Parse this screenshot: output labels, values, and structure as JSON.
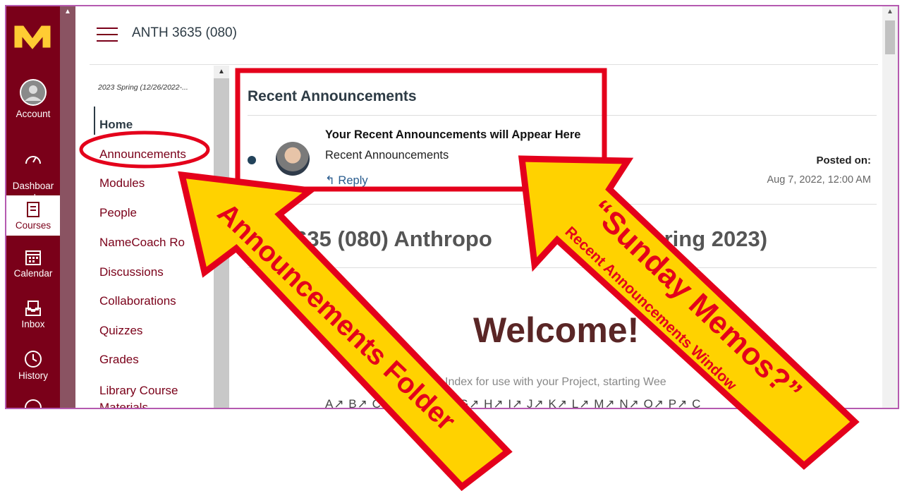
{
  "global_nav": {
    "logo": "M",
    "items": [
      {
        "label": "Account",
        "icon": "account-icon"
      },
      {
        "label": "Dashboar\nd",
        "icon": "dashboard-icon"
      },
      {
        "label": "Courses",
        "icon": "courses-icon"
      },
      {
        "label": "Calendar",
        "icon": "calendar-icon"
      },
      {
        "label": "Inbox",
        "icon": "inbox-icon"
      },
      {
        "label": "History",
        "icon": "history-icon"
      }
    ]
  },
  "header": {
    "breadcrumb": "ANTH 3635 (080)"
  },
  "course_nav": {
    "term": "2023 Spring (12/26/2022-...",
    "items": [
      "Home",
      "Announcements",
      "Modules",
      "People",
      "NameCoach Ro",
      "Discussions",
      "Collaborations",
      "Quizzes",
      "Grades",
      "Library Course\nMaterials"
    ]
  },
  "recent_announcements": {
    "title": "Recent Announcements",
    "item_title": "Your Recent Announcements will Appear Here",
    "item_subtitle": "Recent Announcements",
    "reply": "Reply",
    "posted_label": "Posted on:",
    "posted_date": "Aug 7, 2022, 12:00 AM"
  },
  "course_page": {
    "title": "TH 3635 (080) Anthropo",
    "title_end": "e (Spring 2023)",
    "welcome": "Welcome!",
    "index_text": "Index for use with your Project, starting Wee",
    "letters": "A↗ B↗ C",
    "letters_end": "G↗ H↗ I↗ J↗ K↗ L↗ M↗ N↗ O↗ P↗ C"
  },
  "annotations": {
    "left_arrow": "Announcements Folder",
    "right_arrow_main": "“Sunday Memos?”",
    "right_arrow_sub": "Recent Announcements Window",
    "accent_red": "#e4001b",
    "arrow_yellow": "#ffd200"
  }
}
